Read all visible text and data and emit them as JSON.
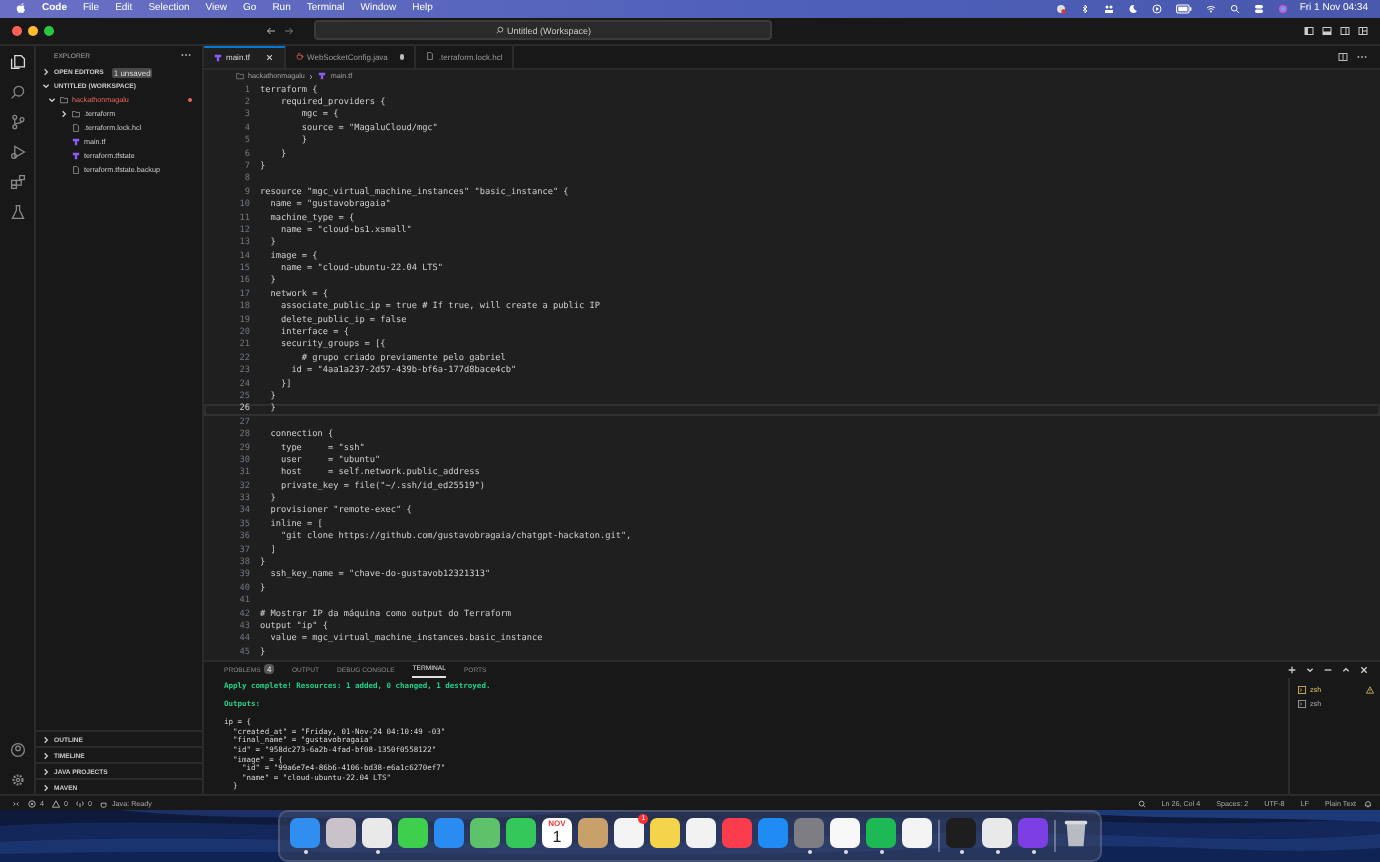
{
  "menu_bar": {
    "app": "Code",
    "items": [
      "File",
      "Edit",
      "Selection",
      "View",
      "Go",
      "Run",
      "Terminal",
      "Window",
      "Help"
    ],
    "clock": "Fri 1 Nov  04:34"
  },
  "title_bar": {
    "search": "Untitled (Workspace)"
  },
  "sidebar": {
    "title": "EXPLORER",
    "open_editors": {
      "label": "OPEN EDITORS",
      "expanded": false,
      "badge": "1 unsaved"
    },
    "workspace": {
      "label": "UNTITLED (WORKSPACE)",
      "expanded": true,
      "tree": [
        {
          "label": "hackathonmagalu",
          "kind": "folder",
          "expanded": true,
          "modified": true,
          "children": [
            {
              "label": ".terraform",
              "kind": "folder",
              "expanded": false,
              "modified": false
            },
            {
              "label": ".terraform.lock.hcl",
              "kind": "file",
              "modified": false
            },
            {
              "label": "main.tf",
              "kind": "terraform",
              "modified": false
            },
            {
              "label": "terraform.tfstate",
              "kind": "terraform",
              "modified": false
            },
            {
              "label": "terraform.tfstate.backup",
              "kind": "file",
              "modified": false
            }
          ]
        }
      ]
    },
    "panels": [
      {
        "label": "OUTLINE",
        "expanded": false
      },
      {
        "label": "TIMELINE",
        "expanded": false
      },
      {
        "label": "JAVA PROJECTS",
        "expanded": false
      },
      {
        "label": "MAVEN",
        "expanded": false
      }
    ]
  },
  "tabs": [
    {
      "label": "main.tf",
      "kind": "terraform",
      "selected": true,
      "dirty": false
    },
    {
      "label": "WebSocketConfig.java",
      "kind": "java",
      "selected": false,
      "dirty": true
    },
    {
      "label": ".terraform.lock.hcl",
      "kind": "file",
      "selected": false,
      "dirty": false
    }
  ],
  "breadcrumb": [
    "hackathonmagalu",
    "main.tf"
  ],
  "editor": {
    "lines": [
      {
        "number": "1",
        "text": "terraform {",
        "current": false
      },
      {
        "number": "2",
        "text": "    required_providers {",
        "current": false
      },
      {
        "number": "3",
        "text": "        mgc = {",
        "current": false
      },
      {
        "number": "4",
        "text": "        source = \"MagaluCloud/mgc\"",
        "current": false
      },
      {
        "number": "5",
        "text": "        }",
        "current": false
      },
      {
        "number": "6",
        "text": "    }",
        "current": false
      },
      {
        "number": "7",
        "text": "}",
        "current": false
      },
      {
        "number": "8",
        "current": false
      },
      {
        "number": "9",
        "text": "resource \"mgc_virtual_machine_instances\" \"basic_instance\" {",
        "current": false
      },
      {
        "number": "10",
        "text": "  name = \"gustavobragaia\"",
        "current": false
      },
      {
        "number": "11",
        "text": "  machine_type = {",
        "current": false
      },
      {
        "number": "12",
        "text": "    name = \"cloud-bs1.xsmall\"",
        "current": false
      },
      {
        "number": "13",
        "text": "  }",
        "current": false
      },
      {
        "number": "14",
        "text": "  image = {",
        "current": false
      },
      {
        "number": "15",
        "text": "    name = \"cloud-ubuntu-22.04 LTS\"",
        "current": false
      },
      {
        "number": "16",
        "text": "  }",
        "current": false
      },
      {
        "number": "17",
        "text": "  network = {",
        "current": false
      },
      {
        "number": "18",
        "text": "    associate_public_ip = true # If true, will create a public IP",
        "current": false
      },
      {
        "number": "19",
        "text": "    delete_public_ip = false",
        "current": false
      },
      {
        "number": "20",
        "text": "    interface = {",
        "current": false
      },
      {
        "number": "21",
        "text": "    security_groups = [{",
        "current": false
      },
      {
        "number": "22",
        "text": "        # grupo criado previamente pelo gabriel",
        "current": false
      },
      {
        "number": "23",
        "text": "      id = \"4aa1a237-2d57-439b-bf6a-177d8bace4cb\"",
        "current": false
      },
      {
        "number": "24",
        "text": "    }]",
        "current": false
      },
      {
        "number": "25",
        "text": "  }",
        "current": false
      },
      {
        "number": "26",
        "text": "  }",
        "current": true
      },
      {
        "number": "27",
        "current": false
      },
      {
        "number": "28",
        "text": "  connection {",
        "current": false
      },
      {
        "number": "29",
        "text": "    type     = \"ssh\"",
        "current": false
      },
      {
        "number": "30",
        "text": "    user     = \"ubuntu\"",
        "current": false
      },
      {
        "number": "31",
        "text": "    host     = self.network.public_address",
        "current": false
      },
      {
        "number": "32",
        "text": "    private_key = file(\"~/.ssh/id_ed25519\")",
        "current": false
      },
      {
        "number": "33",
        "text": "  }",
        "current": false
      },
      {
        "number": "34",
        "text": "  provisioner \"remote-exec\" {",
        "current": false
      },
      {
        "number": "35",
        "text": "  inline = [",
        "current": false
      },
      {
        "number": "36",
        "text": "    \"git clone https://github.com/gustavobragaia/chatgpt-hackaton.git\",",
        "current": false
      },
      {
        "number": "37",
        "text": "  ]",
        "current": false
      },
      {
        "number": "38",
        "text": "}",
        "current": false
      },
      {
        "number": "39",
        "text": "  ssh_key_name = \"chave-do-gustavob12321313\"",
        "current": false
      },
      {
        "number": "40",
        "text": "}",
        "current": false
      },
      {
        "number": "41",
        "current": false
      },
      {
        "number": "42",
        "text": "# Mostrar IP da máquina como output do Terraform",
        "current": false
      },
      {
        "number": "43",
        "text": "output \"ip\" {",
        "current": false
      },
      {
        "number": "44",
        "text": "  value = mgc_virtual_machine_instances.basic_instance",
        "current": false
      },
      {
        "number": "45",
        "text": "}",
        "current": false
      }
    ]
  },
  "panel": {
    "tabs": [
      {
        "label": "PROBLEMS",
        "badge": "4",
        "selected": false
      },
      {
        "label": "OUTPUT",
        "selected": false
      },
      {
        "label": "DEBUG CONSOLE",
        "selected": false
      },
      {
        "label": "TERMINAL",
        "selected": true
      },
      {
        "label": "PORTS",
        "selected": false
      }
    ],
    "terminal": [
      {
        "kind": "success",
        "text": "Apply complete! Resources: 1 added, 0 changed, 1 destroyed."
      },
      {
        "kind": "blank"
      },
      {
        "kind": "success",
        "text": "Outputs:"
      },
      {
        "kind": "blank"
      },
      {
        "kind": "plain",
        "text": "ip = {"
      },
      {
        "kind": "plain",
        "text": "  \"created_at\" = \"Friday, 01-Nov-24 04:10:49 -03\""
      },
      {
        "kind": "plain",
        "text": "  \"final_name\" = \"gustavobragaia\""
      },
      {
        "kind": "plain",
        "text": "  \"id\" = \"958dc273-6a2b-4fad-bf08-1350f0558122\""
      },
      {
        "kind": "plain",
        "text": "  \"image\" = {"
      },
      {
        "kind": "plain",
        "text": "    \"id\" = \"99a6e7e4-86b6-4106-bd38-e6a1c6270ef7\""
      },
      {
        "kind": "plain",
        "text": "    \"name\" = \"cloud-ubuntu-22.04 LTS\""
      },
      {
        "kind": "plain",
        "text": "  }"
      }
    ],
    "sessions": [
      {
        "label": "zsh",
        "selected": true,
        "warning": true
      },
      {
        "label": "zsh",
        "selected": false,
        "warning": false
      }
    ]
  },
  "status_bar": {
    "errors": "4",
    "warnings": "0",
    "ports": "0",
    "java": "Java: Ready",
    "items": [
      "Ln 26, Col 4",
      "Spaces: 2",
      "UTF-8",
      "LF",
      "Plain Text"
    ]
  },
  "dock": [
    {
      "kind": "app",
      "color": "#2f8ef0",
      "running": true
    },
    {
      "kind": "app",
      "color": "#c9c2c8",
      "running": false
    },
    {
      "kind": "app",
      "color": "#e9e9e9",
      "running": true
    },
    {
      "kind": "app",
      "color": "#3fcf4f",
      "running": false
    },
    {
      "kind": "app",
      "color": "#2a8cf0",
      "running": false
    },
    {
      "kind": "app",
      "color": "#5ec26a",
      "running": false
    },
    {
      "kind": "app",
      "color": "#34c759",
      "running": false
    },
    {
      "kind": "calendar",
      "month": "NOV",
      "day": "1",
      "running": false
    },
    {
      "kind": "app",
      "color": "#c8a06a",
      "running": false
    },
    {
      "kind": "app",
      "color": "#f4f4f4",
      "running": false,
      "badge": "1"
    },
    {
      "kind": "app",
      "color": "#f5d34a",
      "running": false
    },
    {
      "kind": "app",
      "color": "#f2f2f2",
      "running": false
    },
    {
      "kind": "app",
      "color": "#fa3c4c",
      "running": false
    },
    {
      "kind": "app",
      "color": "#1f8cf5",
      "running": false
    },
    {
      "kind": "app",
      "color": "#7d7d83",
      "running": true
    },
    {
      "kind": "app",
      "color": "#f8f8f8",
      "running": true
    },
    {
      "kind": "app",
      "color": "#1db954",
      "running": true
    },
    {
      "kind": "app",
      "color": "#f4f4f4",
      "running": false
    },
    {
      "kind": "divider"
    },
    {
      "kind": "app",
      "color": "#1e1e1e",
      "running": true
    },
    {
      "kind": "app",
      "color": "#e9e9e9",
      "running": true
    },
    {
      "kind": "app",
      "color": "#7b3fe4",
      "running": true
    },
    {
      "kind": "divider"
    },
    {
      "kind": "trash",
      "running": false
    }
  ]
}
